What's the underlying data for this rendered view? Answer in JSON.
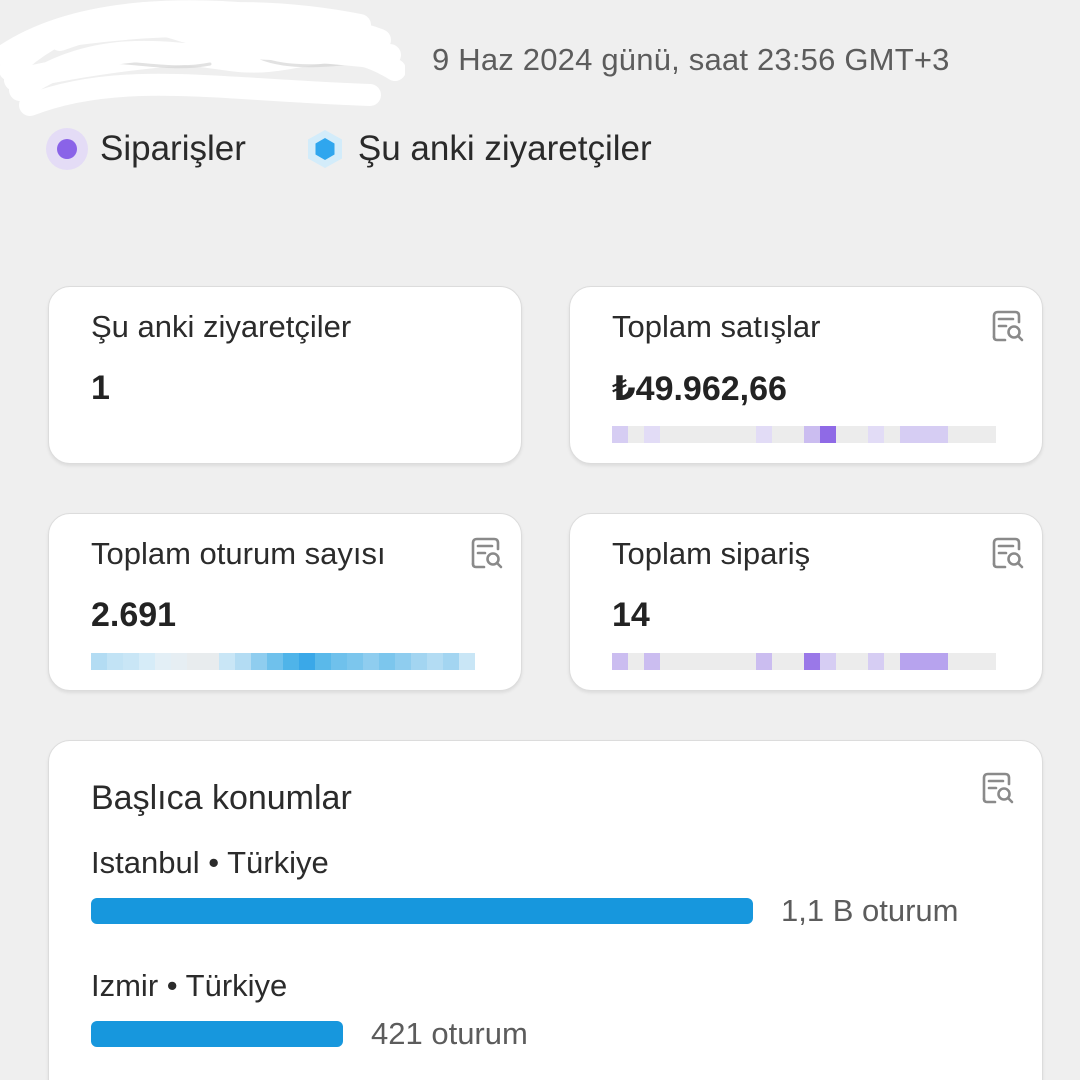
{
  "header": {
    "timestamp": "9 Haz 2024 günü, saat 23:56 GMT+3"
  },
  "legend": [
    {
      "label": "Siparişler",
      "color": "#8a63e8",
      "icon": "purple-dot-icon"
    },
    {
      "label": "Şu anki ziyaretçiler",
      "color": "#3aa8e8",
      "icon": "blue-hexagon-icon"
    }
  ],
  "cards": {
    "visitors": {
      "title": "Şu anki ziyaretçiler",
      "value": "1"
    },
    "sales": {
      "title": "Toplam satışlar",
      "value": "₺49.962,66",
      "icon": "report-icon"
    },
    "sessions": {
      "title": "Toplam oturum sayısı",
      "value": "2.691",
      "icon": "report-icon"
    },
    "orders": {
      "title": "Toplam sipariş",
      "value": "14",
      "icon": "report-icon"
    }
  },
  "locations": {
    "title": "Başlıca konumlar",
    "icon": "report-icon",
    "items": [
      {
        "city": "Istanbul",
        "country": "Türkiye",
        "name": "Istanbul • Türkiye",
        "sessions": "1,1 B oturum",
        "share": 1.0
      },
      {
        "city": "Izmir",
        "country": "Türkiye",
        "name": "Izmir • Türkiye",
        "sessions": "421 oturum",
        "share": 0.38
      }
    ]
  },
  "colors": {
    "accent_purple": "#8a63e8",
    "accent_blue": "#1797dd",
    "background": "#efefef"
  }
}
